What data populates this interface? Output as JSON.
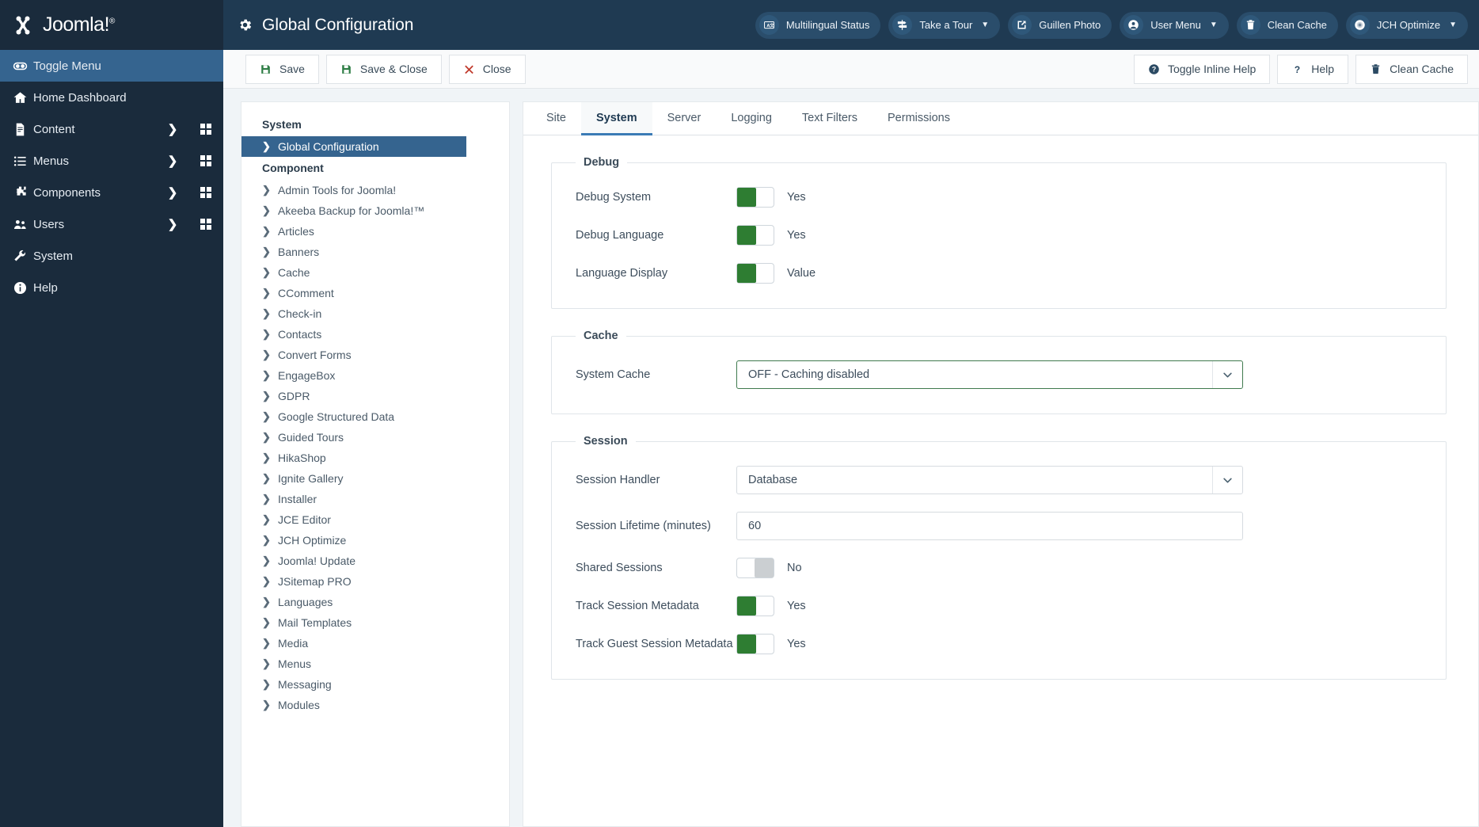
{
  "brand": {
    "name": "Joomla!",
    "trademark": "®"
  },
  "sidebar": {
    "items": [
      {
        "label": "Toggle Menu",
        "icon": "toggle-icon",
        "active": true,
        "caret": false,
        "grid": false
      },
      {
        "label": "Home Dashboard",
        "icon": "home-icon",
        "active": false,
        "caret": false,
        "grid": false
      },
      {
        "label": "Content",
        "icon": "document-icon",
        "active": false,
        "caret": true,
        "grid": true
      },
      {
        "label": "Menus",
        "icon": "list-icon",
        "active": false,
        "caret": true,
        "grid": true
      },
      {
        "label": "Components",
        "icon": "puzzle-icon",
        "active": false,
        "caret": true,
        "grid": true
      },
      {
        "label": "Users",
        "icon": "users-icon",
        "active": false,
        "caret": true,
        "grid": true
      },
      {
        "label": "System",
        "icon": "wrench-icon",
        "active": false,
        "caret": false,
        "grid": false
      },
      {
        "label": "Help",
        "icon": "info-icon",
        "active": false,
        "caret": false,
        "grid": false
      }
    ]
  },
  "header": {
    "title": "Global Configuration",
    "title_icon": "gear-icon",
    "buttons": [
      {
        "label": "Multilingual Status",
        "icon": "language-icon",
        "caret": false
      },
      {
        "label": "Take a Tour",
        "icon": "signpost-icon",
        "caret": true
      },
      {
        "label": "Guillen Photo",
        "icon": "external-link-icon",
        "caret": false
      },
      {
        "label": "User Menu",
        "icon": "user-icon",
        "caret": true
      },
      {
        "label": "Clean Cache",
        "icon": "trash-icon",
        "caret": false
      },
      {
        "label": "JCH Optimize",
        "icon": "circle-icon",
        "caret": true
      }
    ]
  },
  "toolbar": {
    "left": [
      {
        "label": "Save",
        "icon": "save-icon"
      },
      {
        "label": "Save & Close",
        "icon": "save-icon"
      },
      {
        "label": "Close",
        "icon": "x-icon"
      }
    ],
    "right": [
      {
        "label": "Toggle Inline Help",
        "icon": "question-circle-icon"
      },
      {
        "label": "Help",
        "icon": "question-icon"
      },
      {
        "label": "Clean Cache",
        "icon": "trash-icon"
      }
    ]
  },
  "config_nav": {
    "groups": [
      {
        "title": "System",
        "items": [
          {
            "label": "Global Configuration",
            "selected": true
          }
        ]
      },
      {
        "title": "Component",
        "items": [
          {
            "label": "Admin Tools for Joomla!",
            "selected": false
          },
          {
            "label": "Akeeba Backup for Joomla!™",
            "selected": false
          },
          {
            "label": "Articles",
            "selected": false
          },
          {
            "label": "Banners",
            "selected": false
          },
          {
            "label": "Cache",
            "selected": false
          },
          {
            "label": "CComment",
            "selected": false
          },
          {
            "label": "Check-in",
            "selected": false
          },
          {
            "label": "Contacts",
            "selected": false
          },
          {
            "label": "Convert Forms",
            "selected": false
          },
          {
            "label": "EngageBox",
            "selected": false
          },
          {
            "label": "GDPR",
            "selected": false
          },
          {
            "label": "Google Structured Data",
            "selected": false
          },
          {
            "label": "Guided Tours",
            "selected": false
          },
          {
            "label": "HikaShop",
            "selected": false
          },
          {
            "label": "Ignite Gallery",
            "selected": false
          },
          {
            "label": "Installer",
            "selected": false
          },
          {
            "label": "JCE Editor",
            "selected": false
          },
          {
            "label": "JCH Optimize",
            "selected": false
          },
          {
            "label": "Joomla! Update",
            "selected": false
          },
          {
            "label": "JSitemap PRO",
            "selected": false
          },
          {
            "label": "Languages",
            "selected": false
          },
          {
            "label": "Mail Templates",
            "selected": false
          },
          {
            "label": "Media",
            "selected": false
          },
          {
            "label": "Menus",
            "selected": false
          },
          {
            "label": "Messaging",
            "selected": false
          },
          {
            "label": "Modules",
            "selected": false
          }
        ]
      }
    ]
  },
  "tabs": [
    {
      "label": "Site",
      "active": false
    },
    {
      "label": "System",
      "active": true
    },
    {
      "label": "Server",
      "active": false
    },
    {
      "label": "Logging",
      "active": false
    },
    {
      "label": "Text Filters",
      "active": false
    },
    {
      "label": "Permissions",
      "active": false
    }
  ],
  "sections": [
    {
      "legend": "Debug",
      "rows": [
        {
          "label": "Debug System",
          "type": "switch",
          "state": "on",
          "value": "Yes"
        },
        {
          "label": "Debug Language",
          "type": "switch",
          "state": "on",
          "value": "Yes"
        },
        {
          "label": "Language Display",
          "type": "switch",
          "state": "on",
          "value": "Value"
        }
      ]
    },
    {
      "legend": "Cache",
      "rows": [
        {
          "label": "System Cache",
          "type": "select",
          "value": "OFF - Caching disabled",
          "accent": "green"
        }
      ]
    },
    {
      "legend": "Session",
      "rows": [
        {
          "label": "Session Handler",
          "type": "select",
          "value": "Database",
          "accent": "plain"
        },
        {
          "label": "Session Lifetime (minutes)",
          "type": "text",
          "value": "60"
        },
        {
          "label": "Shared Sessions",
          "type": "switch",
          "state": "off",
          "value": "No"
        },
        {
          "label": "Track Session Metadata",
          "type": "switch",
          "state": "on",
          "value": "Yes"
        },
        {
          "label": "Track Guest Session Metadata",
          "type": "switch",
          "state": "on",
          "value": "Yes"
        }
      ]
    }
  ]
}
